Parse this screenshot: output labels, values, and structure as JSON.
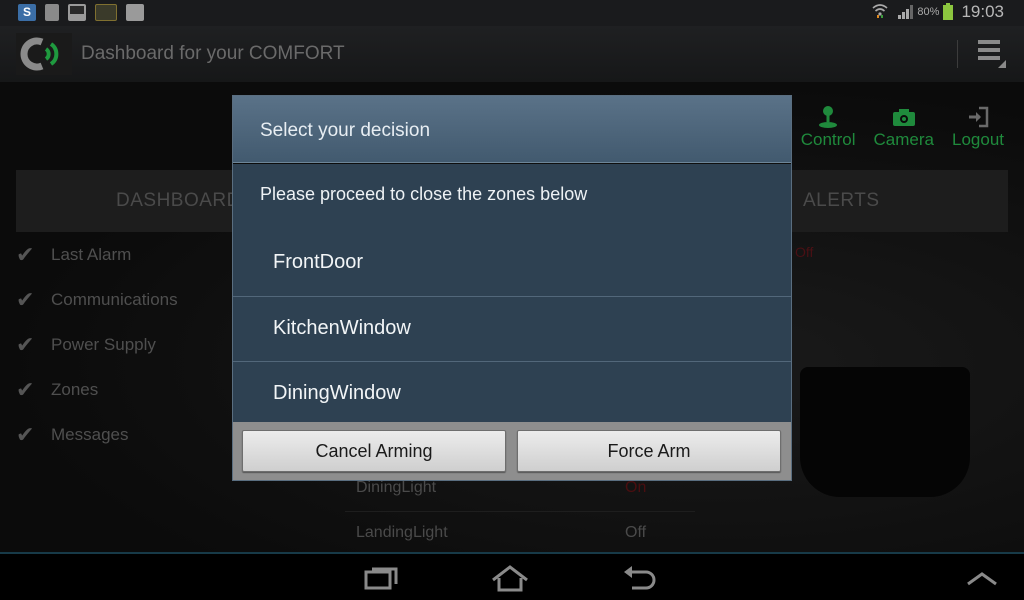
{
  "status_bar": {
    "notification_icons": [
      "skype-icon",
      "document-icon",
      "gallery-icon",
      "tube-icon",
      "play-store-icon"
    ],
    "battery_percent": "80%",
    "time": "19:03",
    "colors": {
      "battery": "#8cc63f"
    }
  },
  "action_bar": {
    "title": "Dashboard for your COMFORT",
    "logo_colors": {
      "ring": "#8a8a8a",
      "waves": "#1f9a3f"
    }
  },
  "nav": {
    "items": [
      {
        "label": "Control",
        "icon": "joystick-icon"
      },
      {
        "label": "Camera",
        "icon": "camera-icon"
      },
      {
        "label": "Logout",
        "icon": "logout-icon"
      }
    ],
    "accent_color": "#1f8a3c"
  },
  "tabs": {
    "dashboard": "DASHBOARD",
    "alerts": "ALERTS"
  },
  "status_checks": [
    {
      "label": "Last Alarm"
    },
    {
      "label": "Communications"
    },
    {
      "label": "Power Supply"
    },
    {
      "label": "Zones"
    },
    {
      "label": "Messages"
    }
  ],
  "alerts": {
    "partial_text": "Off"
  },
  "devices": [
    {
      "name": "DiningLight",
      "state": "On"
    },
    {
      "name": "LandingLight",
      "state": "Off"
    }
  ],
  "dialog": {
    "title": "Select your decision",
    "message": "Please proceed to close the zones below",
    "zones": [
      "FrontDoor",
      "KitchenWindow",
      "DiningWindow"
    ],
    "buttons": {
      "cancel": "Cancel Arming",
      "force": "Force Arm"
    },
    "colors": {
      "header": "#4e667b",
      "body": "#2e4152"
    }
  },
  "system_nav": {
    "buttons": [
      "recent-apps",
      "home",
      "back",
      "expand"
    ]
  }
}
